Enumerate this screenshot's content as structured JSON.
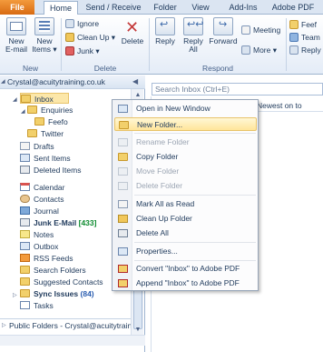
{
  "tabs": [
    {
      "label": "File"
    },
    {
      "label": "Home"
    },
    {
      "label": "Send / Receive"
    },
    {
      "label": "Folder"
    },
    {
      "label": "View"
    },
    {
      "label": "Add-Ins"
    },
    {
      "label": "Adobe PDF"
    }
  ],
  "ribbon": {
    "new_group": {
      "label": "New",
      "new_email": "New\nE-mail",
      "new_email_l1": "New",
      "new_email_l2": "E-mail",
      "new_items_l1": "New",
      "new_items_l2": "Items ▾"
    },
    "delete_group": {
      "label": "Delete",
      "ignore": "Ignore",
      "clean_up": "Clean Up ▾",
      "junk": "Junk ▾",
      "delete": "Delete"
    },
    "respond_group": {
      "label": "Respond",
      "reply": "Reply",
      "reply_all_l1": "Reply",
      "reply_all_l2": "All",
      "forward": "Forward",
      "meeting": "Meeting",
      "more": "More ▾"
    },
    "quick_steps": {
      "item1": "Feef",
      "item2": "Team",
      "item3": "Reply"
    }
  },
  "nav": {
    "account": "Crystal@acuitytraining.co.uk",
    "public_folders": "Public Folders - Crystal@acuitytrain",
    "folders": [
      {
        "name": "Inbox"
      },
      {
        "name": "Enquiries"
      },
      {
        "name": "Feefo"
      },
      {
        "name": "Twitter"
      },
      {
        "name": "Drafts"
      },
      {
        "name": "Sent Items"
      },
      {
        "name": "Deleted Items"
      },
      {
        "name": "Calendar"
      },
      {
        "name": "Contacts"
      },
      {
        "name": "Journal"
      },
      {
        "name": "Junk E-Mail",
        "count": "[433]"
      },
      {
        "name": "Notes"
      },
      {
        "name": "Outbox"
      },
      {
        "name": "RSS Feeds"
      },
      {
        "name": "Search Folders"
      },
      {
        "name": "Suggested Contacts"
      },
      {
        "name": "Sync Issues",
        "count": "(84)"
      },
      {
        "name": "Tasks"
      }
    ]
  },
  "content": {
    "search_placeholder": "Search Inbox (Ctrl+E)",
    "column_header": "Newest on to"
  },
  "context_menu": {
    "items": [
      {
        "label": "Open in New Window",
        "enabled": true
      },
      {
        "label": "New Folder...",
        "enabled": true,
        "highlighted": true
      },
      {
        "label": "Rename Folder",
        "enabled": false
      },
      {
        "label": "Copy Folder",
        "enabled": true
      },
      {
        "label": "Move Folder",
        "enabled": false
      },
      {
        "label": "Delete Folder",
        "enabled": false
      },
      {
        "label": "Mark All as Read",
        "enabled": true
      },
      {
        "label": "Clean Up Folder",
        "enabled": true
      },
      {
        "label": "Delete All",
        "enabled": true
      },
      {
        "label": "Properties...",
        "enabled": true
      },
      {
        "label": "Convert \"Inbox\" to Adobe PDF",
        "enabled": true
      },
      {
        "label": "Append \"Inbox\" to Adobe PDF",
        "enabled": true
      }
    ]
  },
  "colors": {
    "accent": "#f39a3c",
    "selection": "#fce7a9",
    "ribbon_bg": "#e4ecf7",
    "count_green": "#0c8a2e"
  }
}
